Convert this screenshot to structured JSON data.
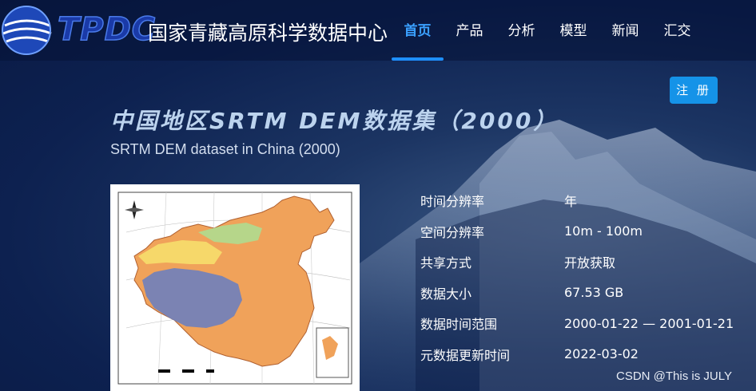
{
  "header": {
    "logo_mark": "TPDC",
    "logo_name": "国家青藏高原科学数据中心",
    "nav": [
      {
        "label": "首页",
        "active": true
      },
      {
        "label": "产品",
        "active": false
      },
      {
        "label": "分析",
        "active": false
      },
      {
        "label": "模型",
        "active": false
      },
      {
        "label": "新闻",
        "active": false
      },
      {
        "label": "汇交",
        "active": false
      }
    ]
  },
  "register_label": "注 册",
  "dataset": {
    "title_cn": "中国地区SRTM  DEM数据集（2000）",
    "title_en": "SRTM DEM dataset in China (2000)",
    "thumbnail_icon": "china-dem-map-thumbnail",
    "metadata": [
      {
        "label": "时间分辨率",
        "value": "年"
      },
      {
        "label": "空间分辨率",
        "value": "10m - 100m"
      },
      {
        "label": "共享方式",
        "value": "开放获取"
      },
      {
        "label": "数据大小",
        "value": "67.53 GB"
      },
      {
        "label": "数据时间范围",
        "value": "2000-01-22 — 2001-01-21"
      },
      {
        "label": "元数据更新时间",
        "value": "2022-03-02"
      }
    ]
  },
  "watermark": "CSDN @This is JULY",
  "colors": {
    "accent": "#1e8fff",
    "button": "#1593e8",
    "background": "#0d2150"
  }
}
